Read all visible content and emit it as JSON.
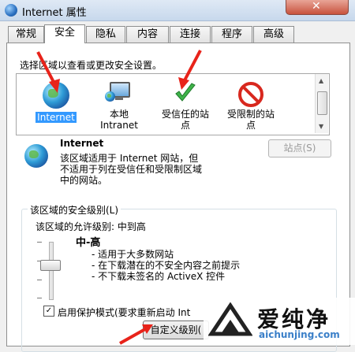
{
  "window": {
    "title": "Internet 属性",
    "close_glyph": "✕"
  },
  "tabs": [
    {
      "label": "常规"
    },
    {
      "label": "安全"
    },
    {
      "label": "隐私"
    },
    {
      "label": "内容"
    },
    {
      "label": "连接"
    },
    {
      "label": "程序"
    },
    {
      "label": "高级"
    }
  ],
  "active_tab": "安全",
  "prompt": "选择区域以查看或更改安全设置。",
  "zones": [
    {
      "label1": "Internet",
      "label2": "",
      "icon": "globe-icon",
      "selected": true
    },
    {
      "label1": "本地",
      "label2": "Intranet",
      "icon": "computer-icon",
      "selected": false
    },
    {
      "label1": "受信任的站",
      "label2": "点",
      "icon": "checkmark-icon",
      "selected": false
    },
    {
      "label1": "受限制的站",
      "label2": "点",
      "icon": "no-entry-icon",
      "selected": false
    }
  ],
  "zone_detail": {
    "name": "Internet",
    "description_lines": [
      "该区域适用于 Internet 网站，但",
      "不适用于列在受信任和受限制区域",
      "中的网站。"
    ],
    "sites_button": "站点(S)"
  },
  "security_level": {
    "group_title": "该区域的安全级别(L)",
    "allowed": "该区域的允许级别: 中到高",
    "level_name": "中-高",
    "bullets": [
      "- 适用于大多数网站",
      "- 在下载潜在的不安全内容之前提示",
      "- 不下载未签名的 ActiveX 控件"
    ]
  },
  "protected_mode": {
    "label": "启用保护模式(要求重新启动 Int",
    "checked": true
  },
  "custom_level_button": "自定义级别(",
  "watermark": {
    "brand": "爱纯净",
    "url": "aichunjing.com"
  },
  "colors": {
    "selection": "#3399ff",
    "arrow": "#e8231a",
    "check": "#3fb34a",
    "noentry": "#d8281e"
  }
}
